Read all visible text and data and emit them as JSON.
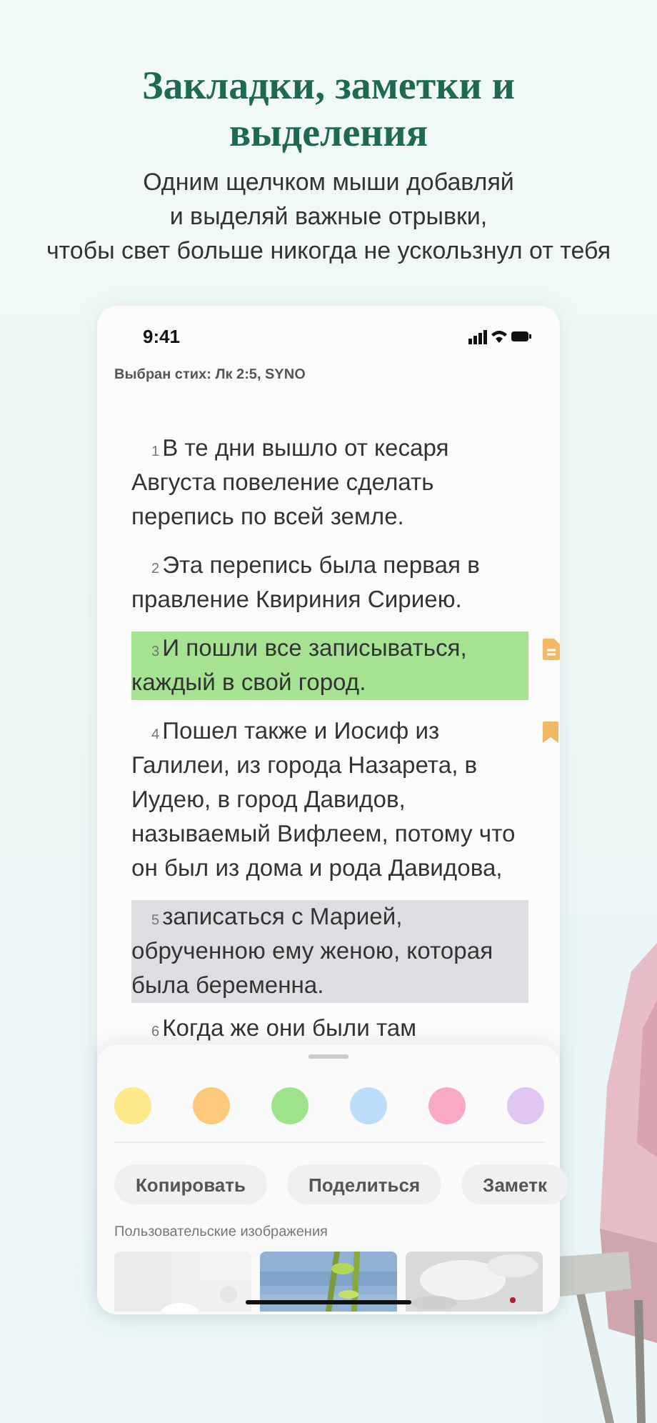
{
  "title": "Закладки, заметки и выделения",
  "subtitle": [
    "Одним щелчком мыши добавляй",
    "и выделяй важные отрывки,",
    "чтобы свет больше никогда не ускользнул от тебя"
  ],
  "phone": {
    "time": "9:41",
    "header": "Выбран стих: Лк 2:5,  SYNO",
    "verses": [
      {
        "number": "1",
        "text": "В те дни вышло от кесаря Августа повеление сделать перепись по всей земле.",
        "has_note": false,
        "bookmarked": false
      },
      {
        "number": "2",
        "text": "Эта перепись была первая в правление Квириния Сириею.",
        "has_note": false,
        "bookmarked": false
      },
      {
        "number": "3",
        "text": "И пошли все записываться, каждый в свой город.",
        "color": "#a5e393",
        "has_note": true,
        "bookmarked": false
      },
      {
        "number": "4",
        "text": "Пошел также и Иосиф из Галилеи, из города Назарета, в Иудею, в город Давидов, называемый Вифлеем, потому что он был из дома и рода Давидова,",
        "has_note": false,
        "bookmarked": true
      },
      {
        "number": "5",
        "text": "записаться с Марией, обрученною ему женою, которая была беременна.",
        "color": "#dcdee1",
        "has_note": false,
        "bookmarked": false
      },
      {
        "number": "6",
        "text": "Когда же они были там",
        "has_note": false,
        "bookmarked": false
      }
    ]
  },
  "sheet": {
    "colors": [
      {
        "color": "#fde98a"
      },
      {
        "color": "#fdc97a"
      },
      {
        "color": "#9de38c"
      },
      {
        "color": "#bcdcfb"
      },
      {
        "color": "#f9a9c4"
      },
      {
        "color": "#dfc6f2"
      }
    ],
    "actions": [
      "Копировать",
      "Поделиться",
      "Заметк"
    ],
    "images_label": "Пользовательские изображения"
  }
}
